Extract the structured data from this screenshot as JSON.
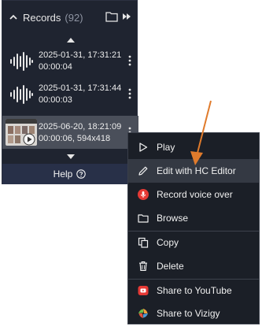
{
  "panel": {
    "title": "Records",
    "count": "(92)",
    "records": [
      {
        "timestamp": "2025-01-31, 17:31:21",
        "detail": "00:00:04",
        "kind": "audio"
      },
      {
        "timestamp": "2025-01-31, 17:31:44",
        "detail": "00:00:03",
        "kind": "audio"
      },
      {
        "timestamp": "2025-06-20, 18:21:09",
        "detail": "00:00:06, 594x418",
        "kind": "video"
      }
    ],
    "help_label": "Help"
  },
  "menu": {
    "items": [
      {
        "label": "Play",
        "icon": "play-icon"
      },
      {
        "label": "Edit with HC Editor",
        "icon": "pencil-icon"
      },
      {
        "label": "Record voice over",
        "icon": "microphone-icon"
      },
      {
        "label": "Browse",
        "icon": "folder-icon"
      },
      {
        "label": "Copy",
        "icon": "copy-icon"
      },
      {
        "label": "Delete",
        "icon": "trash-icon"
      },
      {
        "label": "Share to YouTube",
        "icon": "youtube-icon"
      },
      {
        "label": "Share to Vizigy",
        "icon": "vizigy-icon"
      }
    ]
  },
  "colors": {
    "panel_bg": "#1f2430",
    "help_bar_bg": "#283048",
    "menu_bg": "#1b1f27",
    "highlight": "#343943",
    "accent_red": "#e53935",
    "arrow": "#e07b2c"
  }
}
